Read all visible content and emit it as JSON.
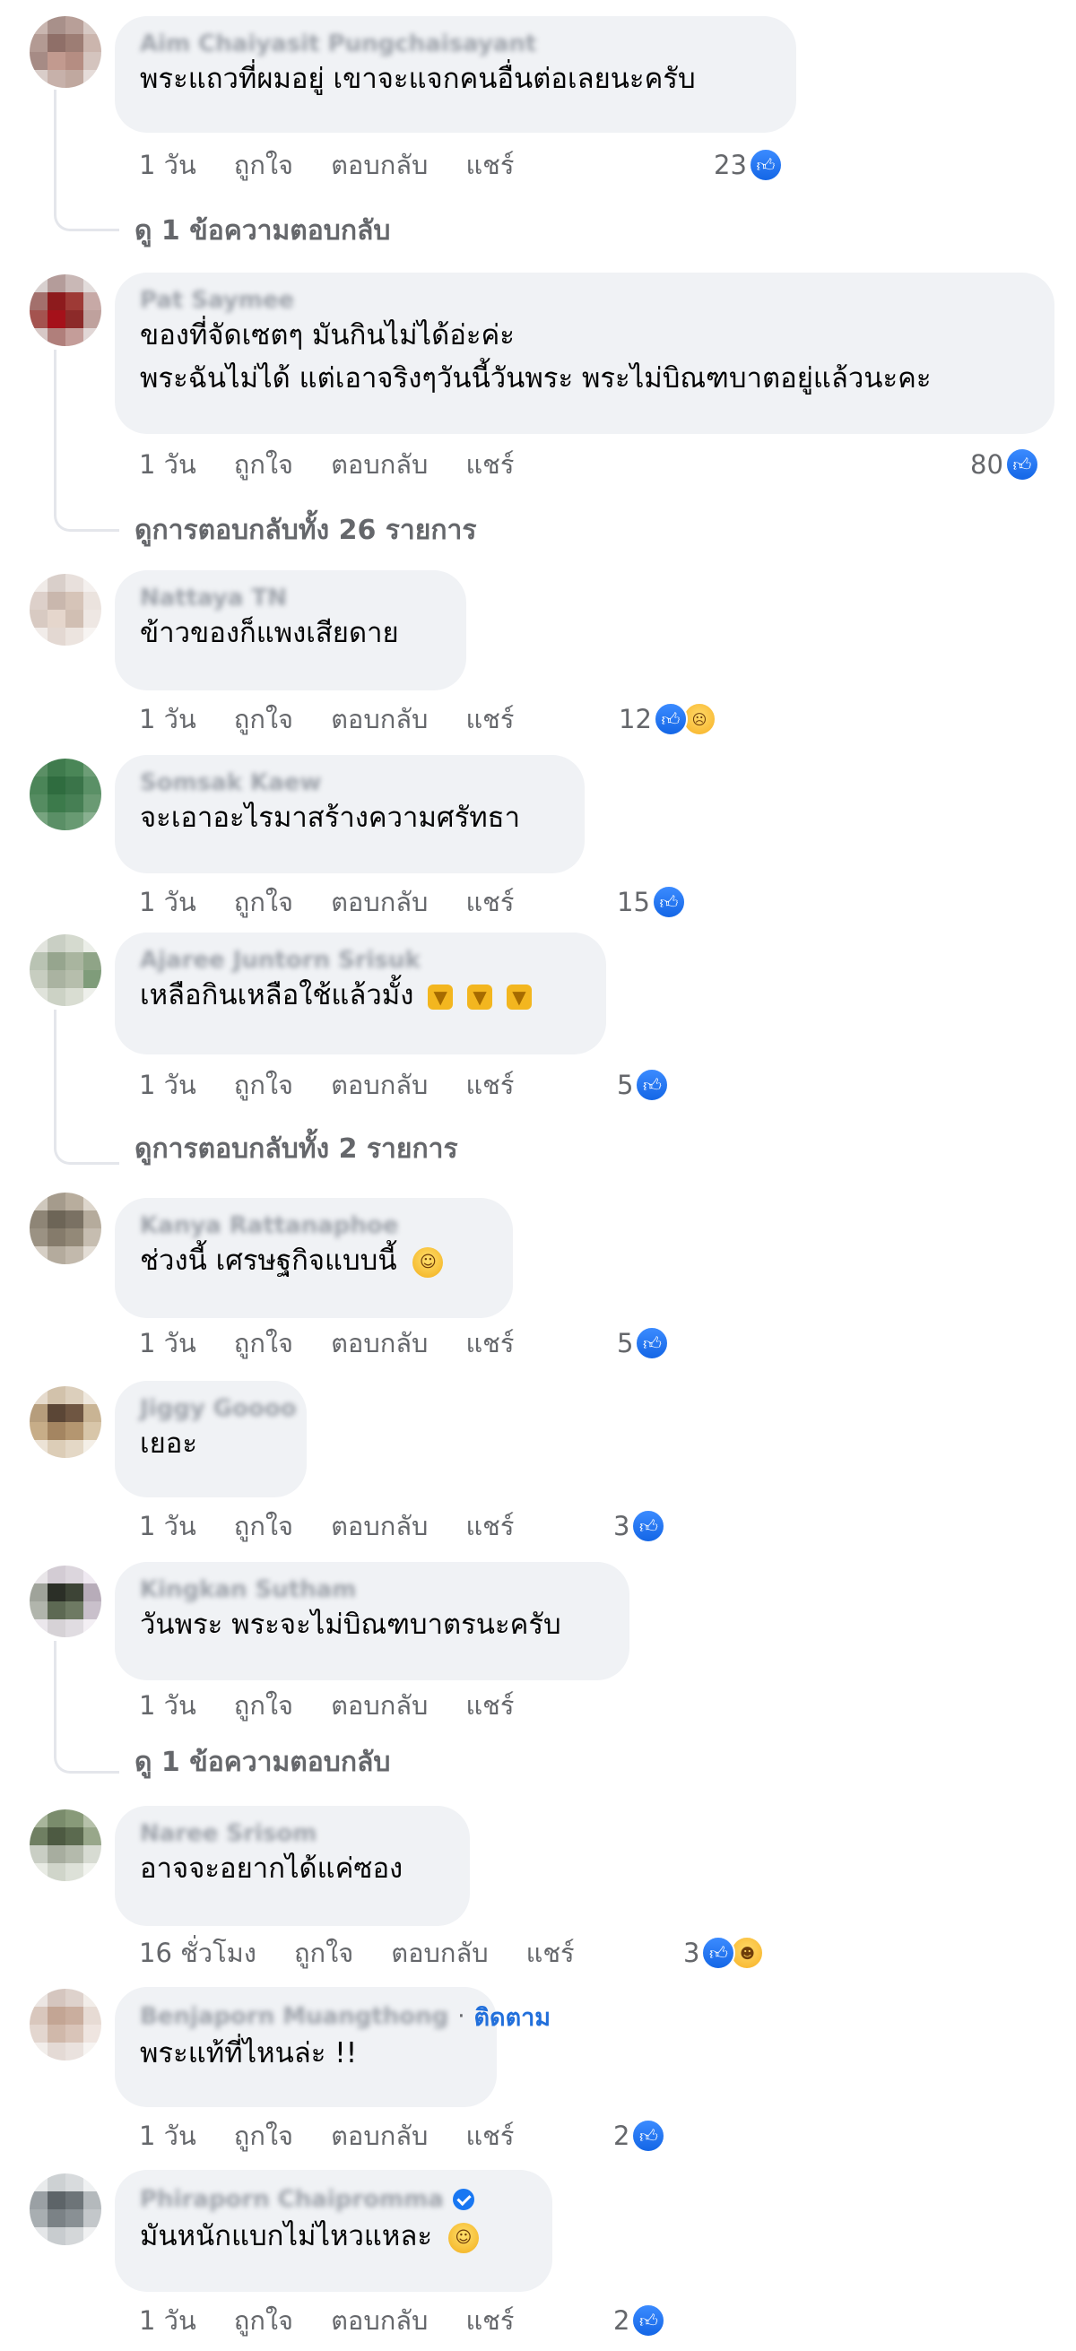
{
  "labels": {
    "like": "ถูกใจ",
    "reply": "ตอบกลับ",
    "share": "แชร์",
    "follow": "ติดตาม",
    "follow_dot": "·"
  },
  "comments": [
    {
      "author": "Aim Chaiyasit Pungchaisayant",
      "lines": [
        "พระแถวที่ผมอยู่ เขาจะแจกคนอื่นต่อเลยนะครับ"
      ],
      "time": "1 วัน",
      "reaction_count": "23",
      "reactions": [
        "like-icon"
      ],
      "replies_label": "ดู 1 ข้อความตอบกลับ"
    },
    {
      "author": "Pat Saymee",
      "lines": [
        "ของที่จัดเซตๆ มันกินไม่ได้อ่ะค่ะ",
        "พระฉันไม่ได้ แต่เอาจริงๆวันนี้วันพระ พระไม่บิณฑบาตอยู่แล้วนะคะ"
      ],
      "time": "1 วัน",
      "reaction_count": "80",
      "reactions": [
        "like-icon"
      ],
      "replies_label": "ดูการตอบกลับทั้ง 26 รายการ"
    },
    {
      "author": "Nattaya TN",
      "lines": [
        "ข้าวของก็แพงเสียดาย"
      ],
      "time": "1 วัน",
      "reaction_count": "12",
      "reactions": [
        "like-icon",
        "sad-icon"
      ]
    },
    {
      "author": "Somsak Kaew",
      "lines": [
        "จะเอาอะไรมาสร้างความศรัทธา"
      ],
      "time": "1 วัน",
      "reaction_count": "15",
      "reactions": [
        "like-icon"
      ]
    },
    {
      "author": "Ajaree Juntorn Srisuk",
      "lines": [
        "เหลือกินเหลือใช้แล้วมั้ง"
      ],
      "emoji": "thumbs-down-icon",
      "time": "1 วัน",
      "reaction_count": "5",
      "reactions": [
        "like-icon"
      ],
      "replies_label": "ดูการตอบกลับทั้ง 2 รายการ"
    },
    {
      "author": "Kanya Rattanaphoe",
      "lines": [
        "ช่วงนี้ เศรษฐกิจแบบนี้"
      ],
      "emoji": "grinning-face-icon",
      "time": "1 วัน",
      "reaction_count": "5",
      "reactions": [
        "like-icon"
      ]
    },
    {
      "author": "Jiggy Goooo",
      "lines": [
        "เยอะ"
      ],
      "time": "1 วัน",
      "reaction_count": "3",
      "reactions": [
        "like-icon"
      ]
    },
    {
      "author": "Kingkan Sutham",
      "lines": [
        "วันพระ พระจะไม่บิณฑบาตรนะครับ"
      ],
      "time": "1 วัน",
      "replies_label": "ดู 1 ข้อความตอบกลับ"
    },
    {
      "author": "Naree Srisom",
      "lines": [
        "อาจจะอยากได้แค่ซอง"
      ],
      "time": "16 ชั่วโมง",
      "reaction_count": "3",
      "reactions": [
        "like-icon",
        "haha-icon"
      ]
    },
    {
      "author": "Benjaporn Muangthong",
      "lines": [
        "พระแท้ที่ไหนล่ะ !!"
      ],
      "time": "1 วัน",
      "reaction_count": "2",
      "reactions": [
        "like-icon"
      ]
    },
    {
      "author": "Phiraporn Chaipromma",
      "lines": [
        "มันหนักแบกไม่ไหวแหละ"
      ],
      "emoji": "smiling-face-icon",
      "time": "1 วัน",
      "reaction_count": "2",
      "reactions": [
        "like-icon"
      ]
    }
  ]
}
